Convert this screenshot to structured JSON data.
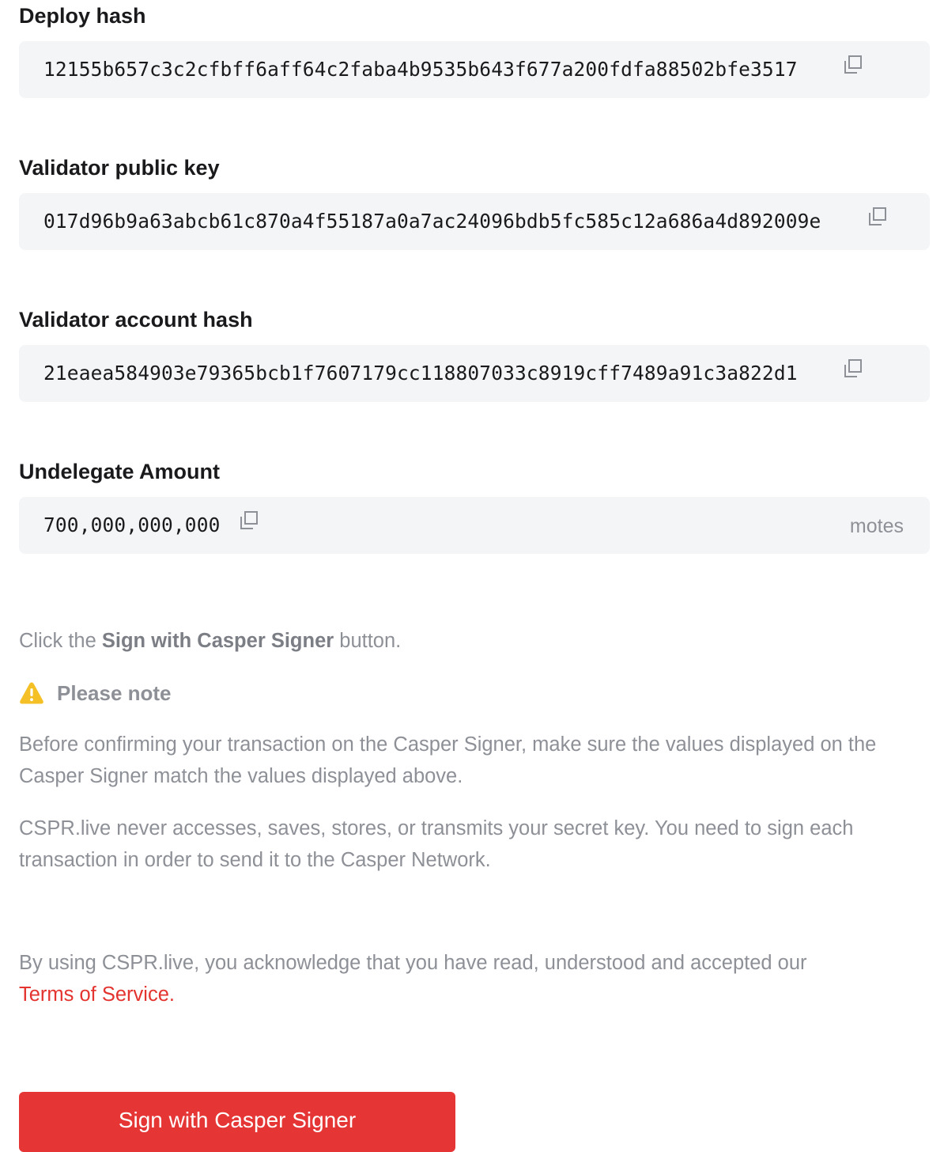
{
  "fields": {
    "deploy_hash": {
      "label": "Deploy hash",
      "value": "12155b657c3c2cfbff6aff64c2faba4b9535b643f677a200fdfa88502bfe3517"
    },
    "validator_public_key": {
      "label": "Validator public key",
      "value": "017d96b9a63abcb61c870a4f55187a0a7ac24096bdb5fc585c12a686a4d892009e"
    },
    "validator_account_hash": {
      "label": "Validator account hash",
      "value": "21eaea584903e79365bcb1f7607179cc118807033c8919cff7489a91c3a822d1"
    },
    "undelegate_amount": {
      "label": "Undelegate Amount",
      "value": "700,000,000,000",
      "unit": "motes"
    }
  },
  "instructions": {
    "prefix": "Click the ",
    "bold": "Sign with Casper Signer",
    "suffix": " button."
  },
  "note": {
    "title": "Please note",
    "paragraph1": "Before confirming your transaction on the Casper Signer, make sure the values displayed on the Casper Signer match the values displayed above.",
    "paragraph2": "CSPR.live never accesses, saves, stores, or transmits your secret key. You need to sign each transaction in order to send it to the Casper Network."
  },
  "terms": {
    "text": "By using CSPR.live, you acknowledge that you have read, understood and accepted our ",
    "link": "Terms of Service."
  },
  "sign_button": {
    "label": "Sign with Casper Signer"
  },
  "colors": {
    "accent": "#e53535",
    "link": "#e3342f",
    "warning": "#f5c026",
    "field_bg": "#f4f5f6",
    "muted_text": "#8e9097"
  },
  "icons": {
    "copy": "copy-icon",
    "warning": "warning-icon"
  }
}
